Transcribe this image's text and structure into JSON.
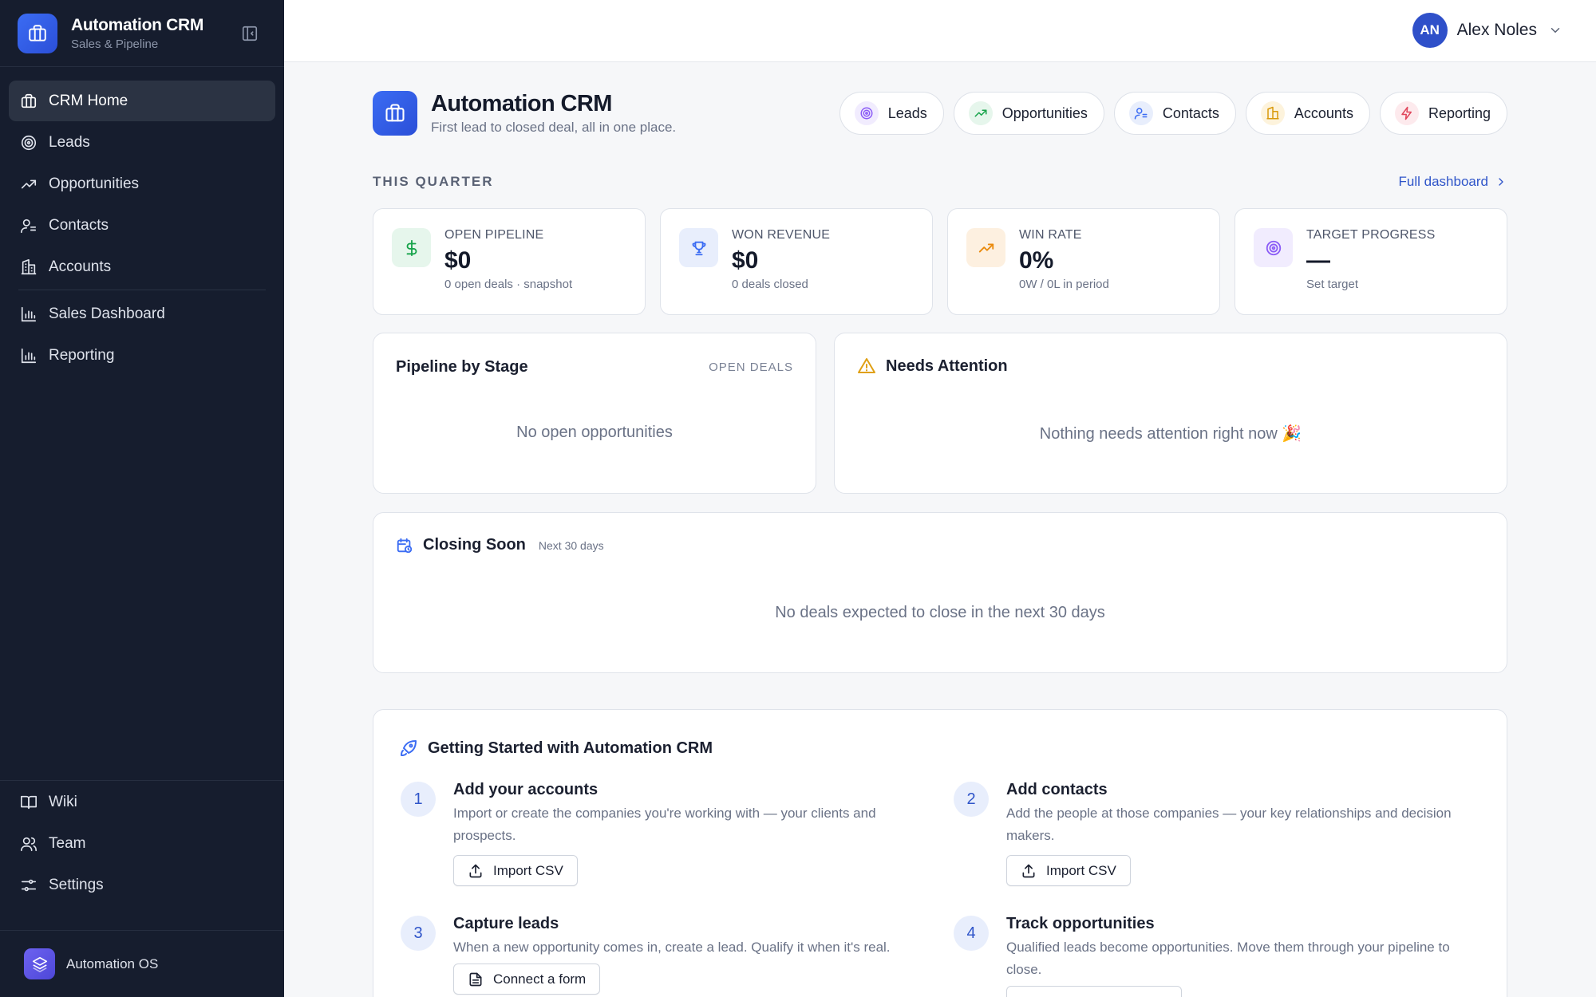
{
  "sidebar": {
    "brand_title": "Automation CRM",
    "brand_subtitle": "Sales & Pipeline",
    "nav": [
      {
        "label": "CRM Home",
        "icon": "briefcase-icon",
        "active": true
      },
      {
        "label": "Leads",
        "icon": "target-icon"
      },
      {
        "label": "Opportunities",
        "icon": "trending-up-icon"
      },
      {
        "label": "Contacts",
        "icon": "user-contacts-icon"
      },
      {
        "label": "Accounts",
        "icon": "building-icon"
      },
      {
        "label": "Sales Dashboard",
        "icon": "bar-chart-icon"
      },
      {
        "label": "Reporting",
        "icon": "bar-chart-icon"
      }
    ],
    "bottom_nav": [
      {
        "label": "Wiki",
        "icon": "book-icon"
      },
      {
        "label": "Team",
        "icon": "team-icon"
      },
      {
        "label": "Settings",
        "icon": "settings-sliders-icon"
      }
    ],
    "os_label": "Automation OS"
  },
  "topbar": {
    "avatar_initials": "AN",
    "user_name": "Alex Noles"
  },
  "header": {
    "title": "Automation CRM",
    "subtitle": "First lead to closed deal, all in one place.",
    "quick_links": [
      {
        "label": "Leads",
        "icon": "target-icon",
        "color": "#8b5cf6"
      },
      {
        "label": "Opportunities",
        "icon": "trending-up-icon",
        "color": "#16a34a"
      },
      {
        "label": "Contacts",
        "icon": "user-contacts-icon",
        "color": "#3b6cf3"
      },
      {
        "label": "Accounts",
        "icon": "building-icon",
        "color": "#d99a0b"
      },
      {
        "label": "Reporting",
        "icon": "bolt-icon",
        "color": "#e0465b"
      }
    ]
  },
  "quarter": {
    "label": "THIS QUARTER",
    "full_dashboard": "Full dashboard",
    "stats": [
      {
        "label": "OPEN PIPELINE",
        "value": "$0",
        "sub": "0 open deals · snapshot",
        "icon": "dollar-icon",
        "color": "#16a34a"
      },
      {
        "label": "WON REVENUE",
        "value": "$0",
        "sub": "0 deals closed",
        "icon": "trophy-icon",
        "color": "#3b6cf3"
      },
      {
        "label": "WIN RATE",
        "value": "0%",
        "sub": "0W / 0L in period",
        "icon": "trending-up-icon",
        "color": "#ea8a0c"
      },
      {
        "label": "TARGET PROGRESS",
        "value": "—",
        "sub": "Set target",
        "icon": "target-icon",
        "color": "#8b5cf6"
      }
    ]
  },
  "pipeline": {
    "title": "Pipeline by Stage",
    "tag": "OPEN DEALS",
    "empty": "No open opportunities"
  },
  "attention": {
    "title": "Needs Attention",
    "empty": "Nothing needs attention right now 🎉"
  },
  "closing": {
    "title": "Closing Soon",
    "tag": "Next 30 days",
    "empty": "No deals expected to close in the next 30 days"
  },
  "getting_started": {
    "title": "Getting Started with Automation CRM",
    "steps": [
      {
        "num": "1",
        "title": "Add your accounts",
        "desc": "Import or create the companies you're working with — your clients and prospects.",
        "button": "Import CSV"
      },
      {
        "num": "2",
        "title": "Add contacts",
        "desc": "Add the people at those companies — your key relationships and decision makers.",
        "button": "Import CSV"
      },
      {
        "num": "3",
        "title": "Capture leads",
        "desc": "When a new opportunity comes in, create a lead. Qualify it when it's real.",
        "button": "Connect a form"
      },
      {
        "num": "4",
        "title": "Track opportunities",
        "desc": "Qualified leads become opportunities. Move them through your pipeline to close.",
        "button": ""
      }
    ]
  }
}
